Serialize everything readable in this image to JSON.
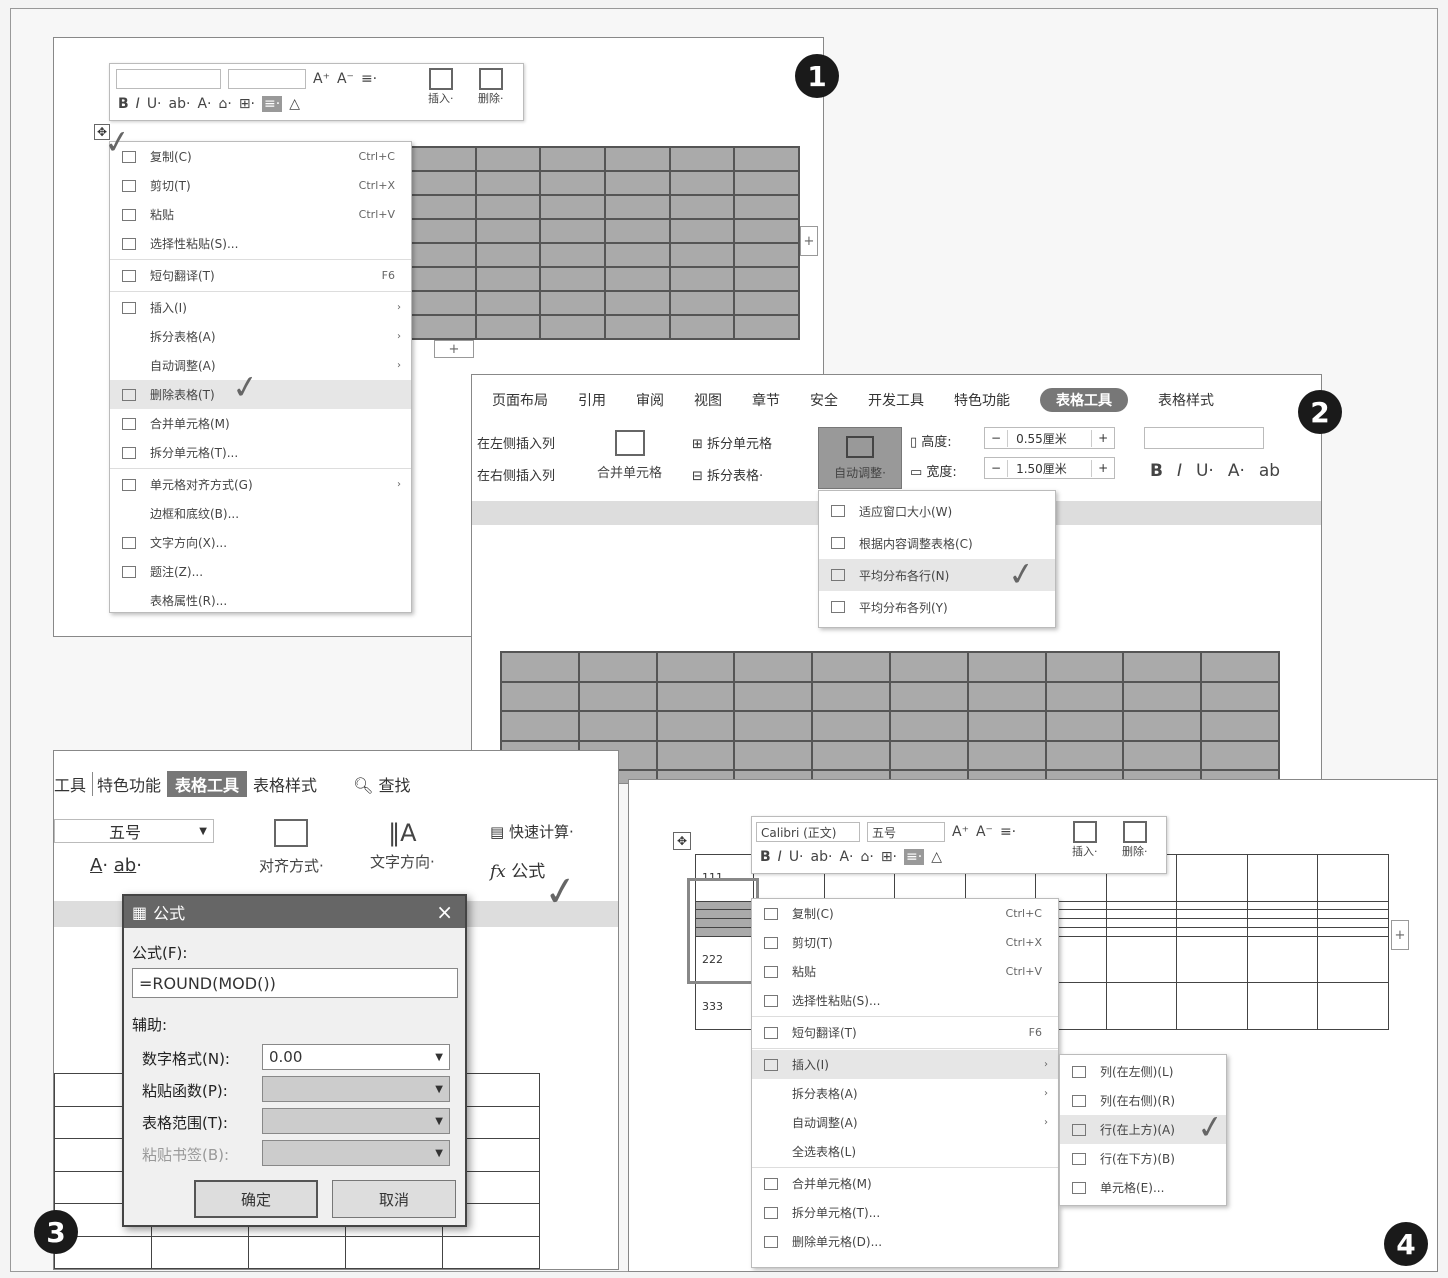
{
  "badges": [
    "1",
    "2",
    "3",
    "4"
  ],
  "panel1": {
    "toolbar": {
      "font_name": "",
      "font_size": "",
      "row1_icons": [
        "A⁺",
        "A⁻",
        "≡·"
      ],
      "row2": [
        "B",
        "I",
        "U·",
        "ab·",
        "A·",
        "⌂·",
        "⊞·",
        "≡·",
        "△"
      ],
      "insert": "插入·",
      "delete": "删除·"
    },
    "menu": [
      {
        "label": "复制(C)",
        "shortcut": "Ctrl+C"
      },
      {
        "label": "剪切(T)",
        "shortcut": "Ctrl+X"
      },
      {
        "label": "粘贴",
        "shortcut": "Ctrl+V"
      },
      {
        "label": "选择性粘贴(S)..."
      },
      {
        "label": "短句翻译(T)",
        "shortcut": "F6"
      },
      {
        "label": "插入(I)",
        "arrow": "›"
      },
      {
        "label": "拆分表格(A)",
        "arrow": "›"
      },
      {
        "label": "自动调整(A)",
        "arrow": "›"
      },
      {
        "label": "删除表格(T)"
      },
      {
        "label": "合并单元格(M)"
      },
      {
        "label": "拆分单元格(T)..."
      },
      {
        "label": "单元格对齐方式(G)",
        "arrow": "›"
      },
      {
        "label": "边框和底纹(B)..."
      },
      {
        "label": "文字方向(X)..."
      },
      {
        "label": "题注(Z)..."
      },
      {
        "label": "表格属性(R)..."
      }
    ],
    "plus": "+"
  },
  "panel2": {
    "tabs": [
      "页面布局",
      "引用",
      "审阅",
      "视图",
      "章节",
      "安全",
      "开发工具",
      "特色功能",
      "表格工具",
      "表格样式"
    ],
    "insert_left": "在左侧插入列",
    "insert_right": "在右侧插入列",
    "merge_cells": "合并单元格",
    "split_cells": "拆分单元格",
    "split_table": "拆分表格·",
    "autofit": "自动调整·",
    "height_label": "高度:",
    "height_value": "0.55厘米",
    "width_label": "宽度:",
    "width_value": "1.50厘米",
    "minus": "−",
    "plus": "+",
    "fmt": [
      "B",
      "I",
      "U·",
      "A·",
      "ab"
    ],
    "menu": [
      "适应窗口大小(W)",
      "根据内容调整表格(C)",
      "平均分布各行(N)",
      "平均分布各列(Y)"
    ]
  },
  "panel3": {
    "tabs": [
      "工具",
      "特色功能",
      "表格工具",
      "表格样式"
    ],
    "search": "查找",
    "font_size": "五号",
    "align": "对齐方式·",
    "text_dir": "文字方向·",
    "quick_calc": "快速计算·",
    "formula_btn": "公式",
    "fx": "fx",
    "dialog": {
      "title": "公式",
      "close": "×",
      "formula_label": "公式(F):",
      "formula_value": "=ROUND(MOD())",
      "assist_label": "辅助:",
      "number_format_label": "数字格式(N):",
      "number_format_value": "0.00",
      "paste_function_label": "粘贴函数(P):",
      "table_range_label": "表格范围(T):",
      "paste_bookmark_label": "粘贴书签(B):",
      "ok": "确定",
      "cancel": "取消"
    }
  },
  "panel4": {
    "toolbar": {
      "font_name": "Calibri (正文)",
      "font_size": "五号",
      "insert": "插入·",
      "delete": "删除·"
    },
    "cells": [
      "111",
      "222",
      "333"
    ],
    "menu": [
      {
        "label": "复制(C)",
        "shortcut": "Ctrl+C"
      },
      {
        "label": "剪切(T)",
        "shortcut": "Ctrl+X"
      },
      {
        "label": "粘贴",
        "shortcut": "Ctrl+V"
      },
      {
        "label": "选择性粘贴(S)..."
      },
      {
        "label": "短句翻译(T)",
        "shortcut": "F6"
      },
      {
        "label": "插入(I)",
        "arrow": "›"
      },
      {
        "label": "拆分表格(A)",
        "arrow": "›"
      },
      {
        "label": "自动调整(A)",
        "arrow": "›"
      },
      {
        "label": "全选表格(L)"
      },
      {
        "label": "合并单元格(M)"
      },
      {
        "label": "拆分单元格(T)..."
      },
      {
        "label": "删除单元格(D)..."
      }
    ],
    "submenu": [
      "列(在左侧)(L)",
      "列(在右侧)(R)",
      "行(在上方)(A)",
      "行(在下方)(B)",
      "单元格(E)..."
    ],
    "plus": "+"
  }
}
